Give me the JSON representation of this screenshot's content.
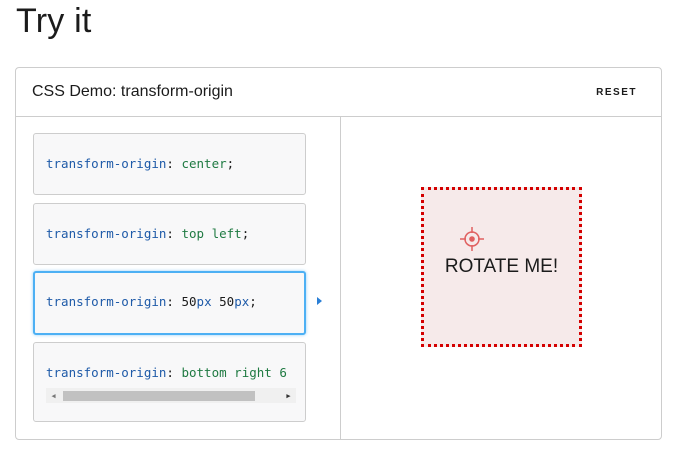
{
  "page": {
    "heading": "Try it"
  },
  "demo": {
    "title": "CSS Demo: transform-origin",
    "reset_label": "RESET",
    "choices": [
      {
        "property": "transform-origin",
        "colon": ":",
        "value": "center",
        "semicolon": ";"
      },
      {
        "property": "transform-origin",
        "colon": ":",
        "value": "top left",
        "semicolon": ";"
      },
      {
        "property": "transform-origin",
        "colon": ":",
        "value_num1": "50",
        "value_unit1": "px",
        "value_num2": "50",
        "value_unit2": "px",
        "semicolon": ";",
        "selected": true
      },
      {
        "property": "transform-origin",
        "colon": ":",
        "value": "bottom right 6"
      }
    ],
    "output": {
      "label": "ROTATE ME!"
    }
  },
  "icons": {
    "scroll_left": "scroll-left-arrow-icon",
    "scroll_right": "scroll-right-arrow-icon",
    "selected_marker": "caret-right-icon",
    "origin_marker": "crosshair-icon"
  },
  "colors": {
    "property": "#1e5aa8",
    "value": "#1f7a42",
    "selected_border": "#4db0f4",
    "target_border": "#d40000",
    "target_fill": "#f6eaea",
    "crosshair": "#e06060"
  }
}
